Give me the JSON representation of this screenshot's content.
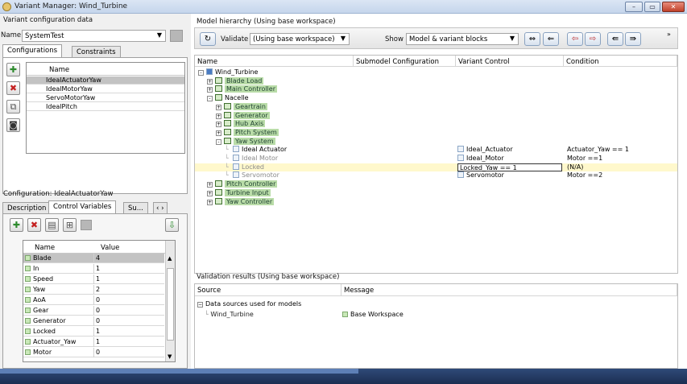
{
  "window": {
    "title": "Variant Manager: Wind_Turbine",
    "buttons": [
      "–",
      "▭",
      "✕"
    ]
  },
  "left": {
    "section_title": "Variant configuration data",
    "name_label": "Name",
    "name_value": "SystemTest",
    "tabs": [
      "Configurations",
      "Constraints"
    ],
    "configs_header": "Name",
    "configs": [
      "IdealActuatorYaw",
      "IdealMotorYaw",
      "ServoMotorYaw",
      "IdealPitch"
    ],
    "selected_config": "IdealActuatorYaw",
    "config_label": "Configuration: IdealActuatorYaw",
    "detail_tabs": [
      "Description",
      "Control Variables",
      "Su...",
      "‹ ›"
    ],
    "vars_headers": [
      "Name",
      "Value"
    ],
    "vars": [
      {
        "name": "Blade",
        "value": "4"
      },
      {
        "name": "In",
        "value": "1"
      },
      {
        "name": "Speed",
        "value": "1"
      },
      {
        "name": "Yaw",
        "value": "2"
      },
      {
        "name": "AoA",
        "value": "0"
      },
      {
        "name": "Gear",
        "value": "0"
      },
      {
        "name": "Generator",
        "value": "0"
      },
      {
        "name": "Locked",
        "value": "1"
      },
      {
        "name": "Actuator_Yaw",
        "value": "1"
      },
      {
        "name": "Motor",
        "value": "0"
      }
    ]
  },
  "right": {
    "hierarchy_title": "Model hierarchy (Using base workspace)",
    "validate_label": "Validate",
    "validate_combo": "(Using base workspace)",
    "show_label": "Show",
    "show_combo": "Model & variant blocks",
    "overflow": "»",
    "columns": [
      "Name",
      "Submodel Configuration",
      "Variant Control",
      "Condition"
    ],
    "tree": [
      {
        "name": "Wind_Turbine",
        "indent": 0,
        "kind": "root",
        "exp": "-"
      },
      {
        "name": "Blade Load",
        "indent": 1,
        "kind": "green",
        "exp": "+"
      },
      {
        "name": "Main Controller",
        "indent": 1,
        "kind": "green",
        "exp": "+"
      },
      {
        "name": "Nacelle",
        "indent": 1,
        "kind": "plain",
        "exp": "-"
      },
      {
        "name": "Geartrain",
        "indent": 2,
        "kind": "green",
        "exp": "+"
      },
      {
        "name": "Generator",
        "indent": 2,
        "kind": "green",
        "exp": "+"
      },
      {
        "name": "Hub Axis",
        "indent": 2,
        "kind": "green",
        "exp": "+"
      },
      {
        "name": "Pitch System",
        "indent": 2,
        "kind": "green",
        "exp": "+"
      },
      {
        "name": "Yaw System",
        "indent": 2,
        "kind": "green",
        "exp": "-"
      },
      {
        "name": "Ideal Actuator",
        "indent": 3,
        "kind": "variant",
        "control": "Ideal_Actuator",
        "condition": "Actuator_Yaw == 1"
      },
      {
        "name": "Ideal Motor",
        "indent": 3,
        "kind": "variant-grey",
        "control": "Ideal_Motor",
        "condition": "Motor ==1"
      },
      {
        "name": "Locked",
        "indent": 3,
        "kind": "variant-grey",
        "control": "Locked_Yaw == 1",
        "condition": "(N/A)",
        "highlight": true
      },
      {
        "name": "Servomotor",
        "indent": 3,
        "kind": "variant-grey",
        "control": "Servomotor",
        "condition": "Motor ==2"
      },
      {
        "name": "Pitch Controller",
        "indent": 1,
        "kind": "green",
        "exp": "+"
      },
      {
        "name": "Turbine Input",
        "indent": 1,
        "kind": "green",
        "exp": "+"
      },
      {
        "name": "Yaw Controller",
        "indent": 1,
        "kind": "green",
        "exp": "+"
      }
    ],
    "validation_title": "Validation results (Using base workspace)",
    "validation_columns": [
      "Source",
      "Message"
    ],
    "validation_group": "Data sources used for models",
    "validation_source": "Wind_Turbine",
    "validation_message": "Base Workspace"
  }
}
